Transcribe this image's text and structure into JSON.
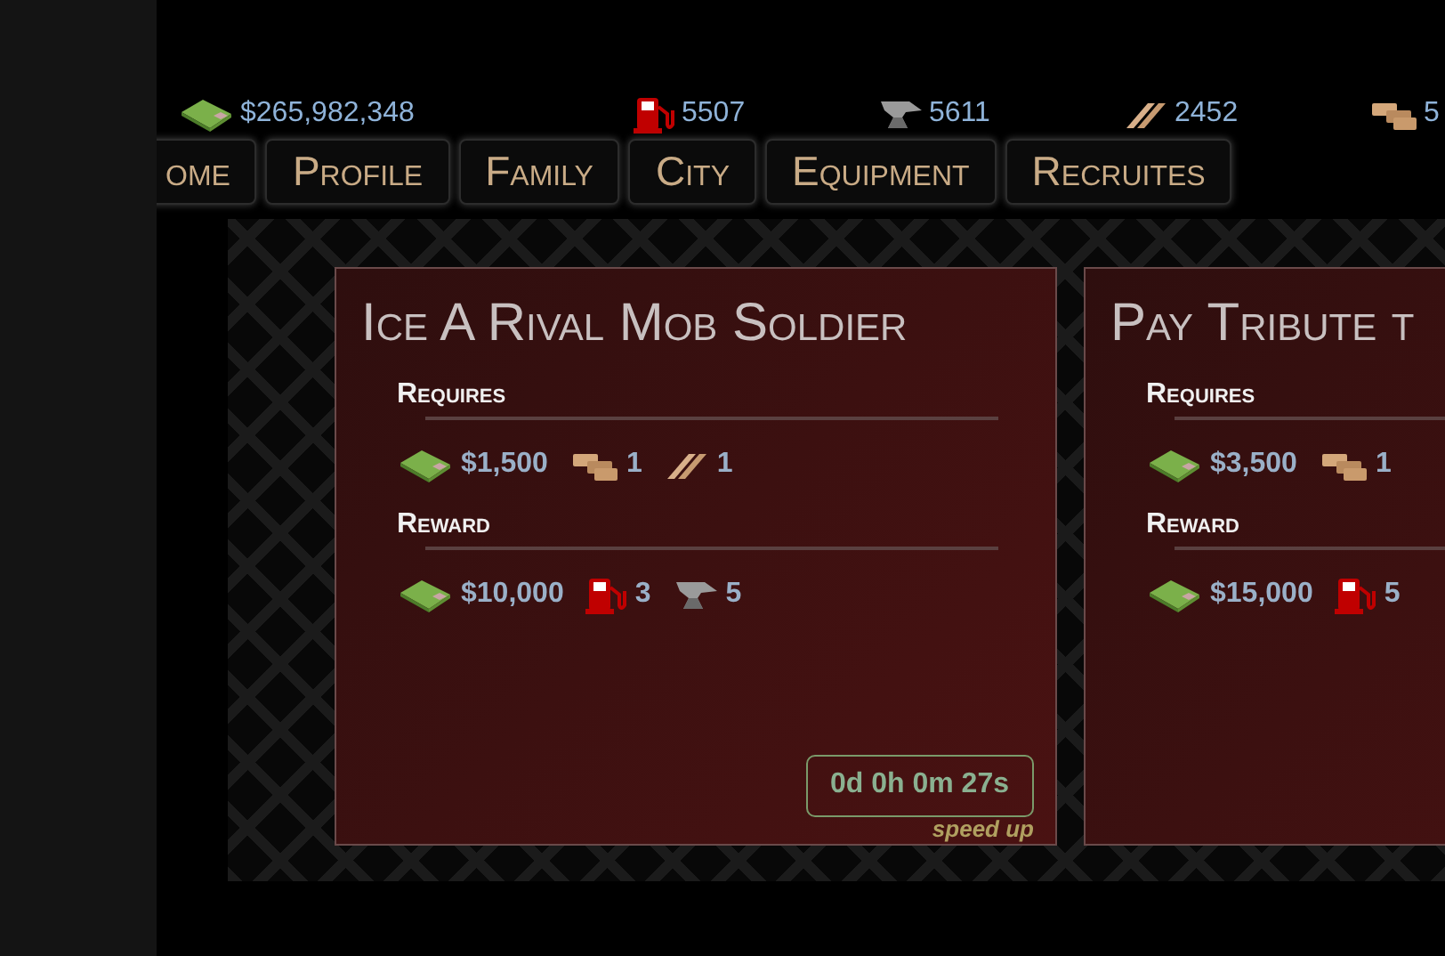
{
  "resources": [
    {
      "kind": "cash",
      "value": "$265,982,348"
    },
    {
      "kind": "fuel",
      "value": "5507"
    },
    {
      "kind": "anvil",
      "value": "5611"
    },
    {
      "kind": "planks",
      "value": "2452"
    },
    {
      "kind": "bricks",
      "value": "5"
    }
  ],
  "nav": [
    {
      "label": "ome"
    },
    {
      "label": "Profile"
    },
    {
      "label": "Family"
    },
    {
      "label": "City"
    },
    {
      "label": "Equipment"
    },
    {
      "label": "Recruites"
    }
  ],
  "missions": [
    {
      "title": "Ice A Rival Mob Soldier",
      "requires_label": "Requires",
      "requires": [
        {
          "kind": "cash",
          "value": "$1,500"
        },
        {
          "kind": "bricks",
          "value": "1"
        },
        {
          "kind": "planks",
          "value": "1"
        }
      ],
      "reward_label": "Reward",
      "reward": [
        {
          "kind": "cash",
          "value": "$10,000"
        },
        {
          "kind": "fuel",
          "value": "3"
        },
        {
          "kind": "anvil",
          "value": "5"
        }
      ],
      "timer": "0d 0h 0m 27s",
      "speed_up": "speed up"
    },
    {
      "title": "Pay Tribute t",
      "requires_label": "Requires",
      "requires": [
        {
          "kind": "cash",
          "value": "$3,500"
        },
        {
          "kind": "bricks",
          "value": "1"
        }
      ],
      "reward_label": "Reward",
      "reward": [
        {
          "kind": "cash",
          "value": "$15,000"
        },
        {
          "kind": "fuel",
          "value": "5"
        }
      ]
    }
  ]
}
